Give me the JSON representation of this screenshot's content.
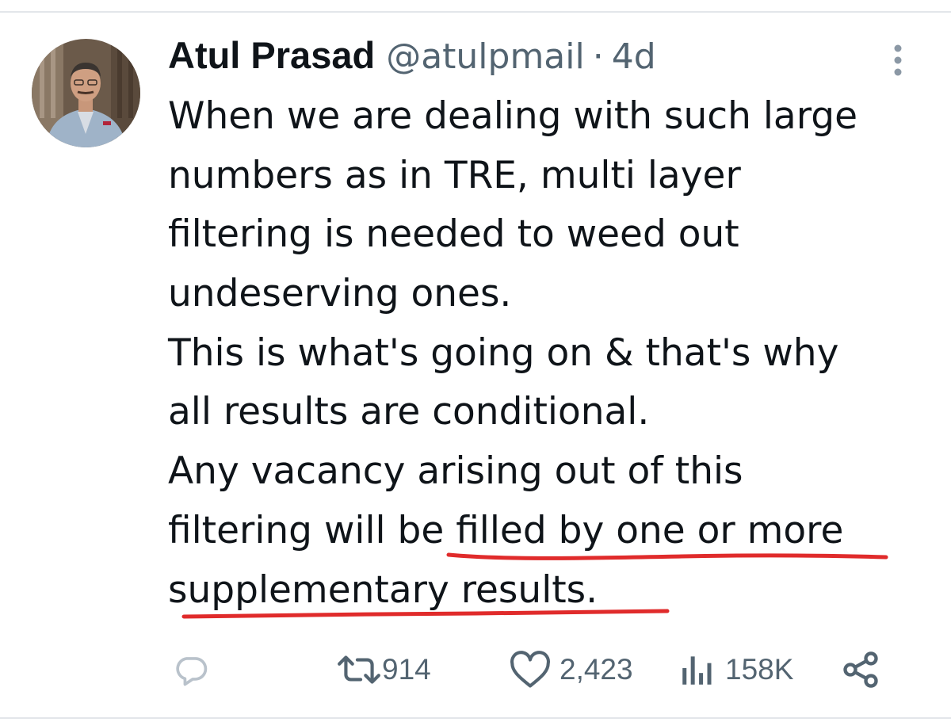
{
  "tweet": {
    "author": {
      "name": "Atul Prasad",
      "handle": "@atulpmail"
    },
    "separator": "·",
    "time": "4d",
    "text_lines": [
      "When we are dealing with such large",
      "numbers as in TRE, multi layer",
      "filtering is needed to weed out",
      "undeserving ones.",
      "This is what's going on & that's why",
      "all results are conditional.",
      "Any vacancy arising out of this",
      "filtering will be filled by one or more",
      "supplementary results."
    ],
    "annotation": {
      "type": "hand-drawn underline",
      "color": "#e02b2b",
      "underlined_text": "filled by one or more supplementary results."
    }
  },
  "actions": {
    "reply": {
      "icon": "reply-icon",
      "count": ""
    },
    "retweet": {
      "icon": "retweet-icon",
      "count": "914"
    },
    "like": {
      "icon": "heart-icon",
      "count": "2,423"
    },
    "views": {
      "icon": "views-chart-icon",
      "count": "158K"
    },
    "share": {
      "icon": "share-icon"
    }
  },
  "colors": {
    "text": "#0f1419",
    "secondary": "#536471",
    "divider": "#e3e6ea",
    "annotation_red": "#e02b2b"
  }
}
